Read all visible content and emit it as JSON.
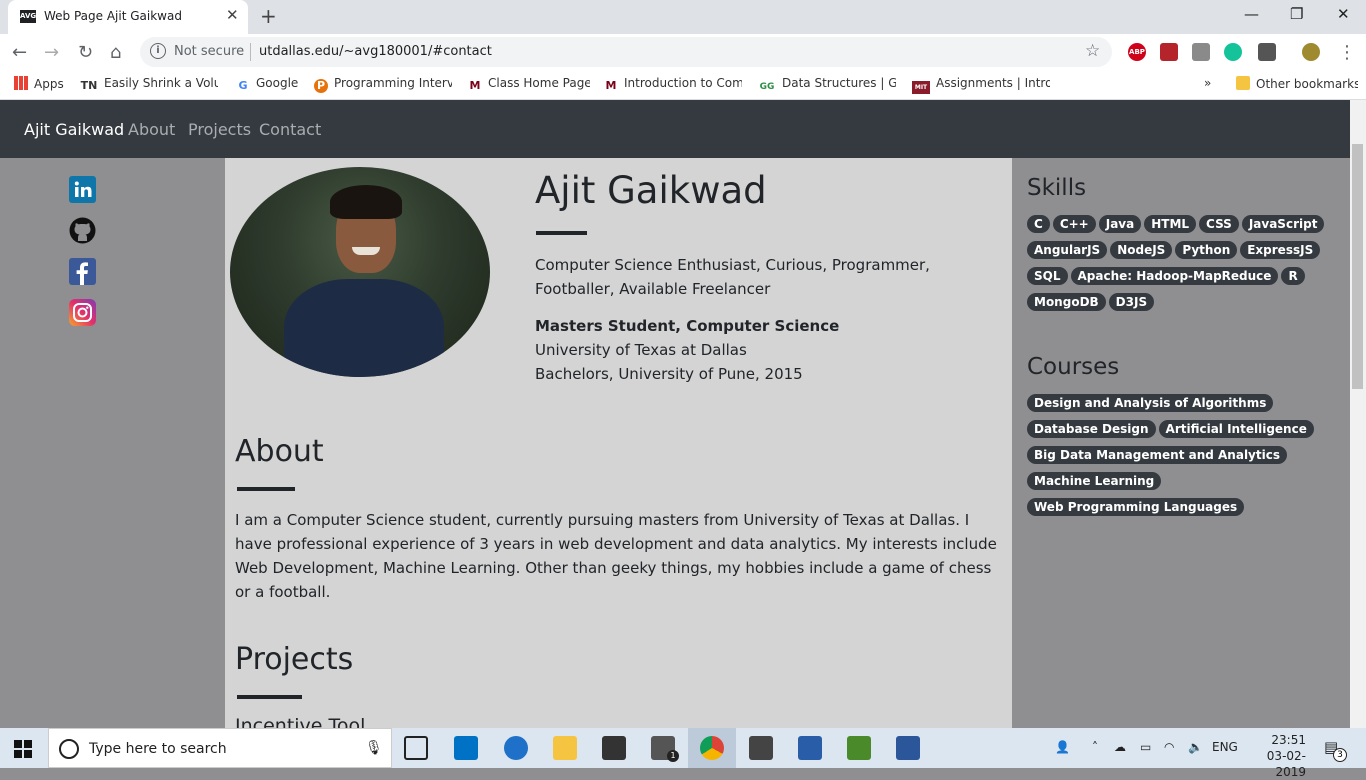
{
  "browser": {
    "tab_title": "Web Page Ajit Gaikwad",
    "tab_favicon": "AVG",
    "security_label": "Not secure",
    "url": "utdallas.edu/~avg180001/#contact",
    "bookmarks": [
      {
        "label": "Apps",
        "icon": "apps-grid-icon"
      },
      {
        "label": "Easily Shrink a Volume",
        "icon": "TN"
      },
      {
        "label": "Google",
        "icon": "G"
      },
      {
        "label": "Programming Interview",
        "icon": "P"
      },
      {
        "label": "Class Home Pages",
        "icon": "M"
      },
      {
        "label": "Introduction to Comp",
        "icon": "M"
      },
      {
        "label": "Data Structures | Gee",
        "icon": "GG"
      },
      {
        "label": "Assignments | Introdu",
        "icon": "MIT"
      },
      {
        "label": "Other bookmarks",
        "icon": "folder-icon"
      }
    ],
    "overflow": "»"
  },
  "site": {
    "brand": "Ajit Gaikwad",
    "nav": [
      "About",
      "Projects",
      "Contact"
    ],
    "name": "Ajit Gaikwad",
    "tagline": "Computer Science Enthusiast, Curious, Programmer, Footballer, Available Freelancer",
    "degree": "Masters Student, Computer Science",
    "university": "University of Texas at Dallas",
    "bachelors": "Bachelors, University of Pune, 2015",
    "about_heading": "About",
    "about_text": "I am a Computer Science student, currently pursuing masters from University of Texas at Dallas. I have professional experience of 3 years in web development and data analytics. My interests include Web Development, Machine Learning. Other than geeky things, my hobbies include a game of chess or a football.",
    "projects_heading": "Projects",
    "project_title": "Incentive Tool",
    "skills_heading": "Skills",
    "skills": [
      "C",
      "C++",
      "Java",
      "HTML",
      "CSS",
      "JavaScript",
      "AngularJS",
      "NodeJS",
      "Python",
      "ExpressJS",
      "SQL",
      "Apache: Hadoop-MapReduce",
      "R",
      "MongoDB",
      "D3JS"
    ],
    "courses_heading": "Courses",
    "courses": [
      "Design and Analysis of Algorithms",
      "Database Design",
      "Artificial Intelligence",
      "Big Data Management and Analytics",
      "Machine Learning",
      "Web Programming Languages"
    ],
    "social": [
      "linkedin-icon",
      "github-icon",
      "facebook-icon",
      "instagram-icon"
    ]
  },
  "taskbar": {
    "search_placeholder": "Type here to search",
    "language": "ENG",
    "time": "23:51",
    "date": "03-02-2019",
    "notification_count": "3",
    "mail_badge": "1"
  }
}
